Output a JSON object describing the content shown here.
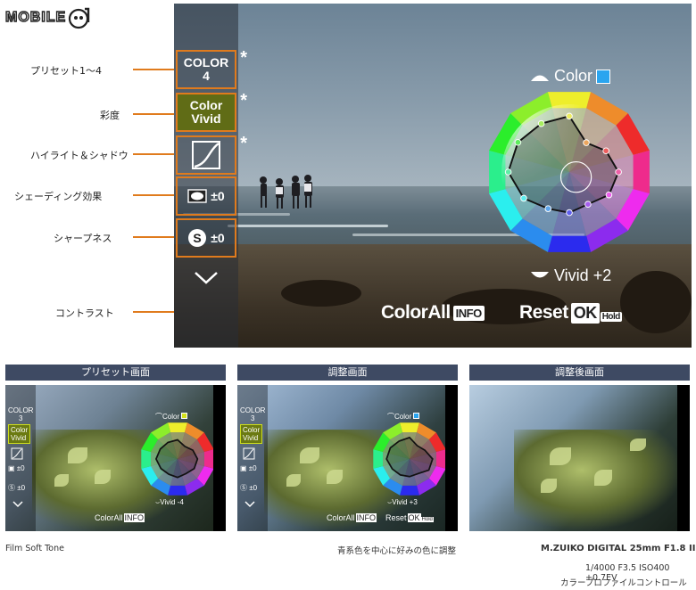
{
  "logo": {
    "text": "MOBILE",
    "emblem": "01-emblem-icon"
  },
  "labels": [
    "プリセット1～4",
    "彩度",
    "ハイライト＆シャドウ",
    "シェーディング効果",
    "シャープネス",
    "コントラスト"
  ],
  "panel": {
    "preset": {
      "line1": "COLOR",
      "line2": "4",
      "star": "*"
    },
    "saturation": {
      "line1": "Color",
      "line2": "Vivid",
      "star": "*"
    },
    "highlight_star": "*",
    "shading_value": "±0",
    "sharpness_value": "±0"
  },
  "wheel": {
    "color_label": "Color",
    "vivid_label": "Vivid +2",
    "swatch_color": "#2aa5ef"
  },
  "buttons": {
    "colorall": "ColorAll",
    "info_key": "INFO",
    "reset": "Reset",
    "ok_key": "OK",
    "hold_key": "Hold"
  },
  "sections": [
    {
      "title": "プリセット画面"
    },
    {
      "title": "調整画面"
    },
    {
      "title": "調整後画面"
    }
  ],
  "thumb1": {
    "preset1": "COLOR",
    "preset2": "3",
    "sat1": "Color",
    "sat2": "Vivid",
    "shade": "±0",
    "sharp": "±0",
    "color_label": "Color",
    "vivid_label": "Vivid -4",
    "btn": "ColorAll",
    "key": "INFO"
  },
  "thumb2": {
    "preset1": "COLOR",
    "preset2": "3",
    "sat1": "Color",
    "sat2": "Vivid",
    "shade": "±0",
    "sharp": "±0",
    "color_label": "Color",
    "vivid_label": "Vivid +3",
    "btn": "ColorAll",
    "key": "INFO",
    "reset": "Reset",
    "ok": "OK",
    "hold": "Hold"
  },
  "captions": {
    "left": "Film Soft Tone",
    "middle": "青系色を中心に好みの色に調整",
    "right_title": "M.ZUIKO DIGITAL 25mm F1.8 II",
    "right_exif": "1/4000 F3.5 ISO400 +0.7EV",
    "right_mode": "カラープロファイルコントロール"
  },
  "accent_color": "#e07b1d",
  "header_color": "#3e4a63"
}
